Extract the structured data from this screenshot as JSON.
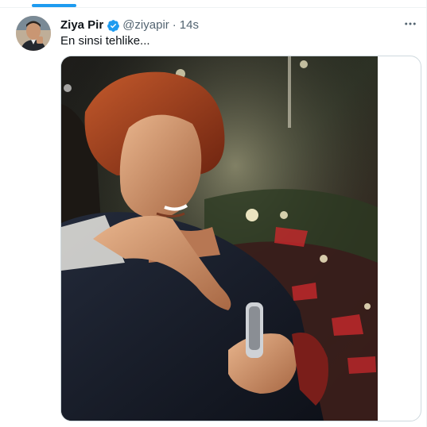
{
  "tweet": {
    "author_name": "Ziya Pir",
    "handle": "@ziyapir",
    "separator": "·",
    "timestamp": "14s",
    "text": "En sinsi tehlike...",
    "more_icon": "more-horizontal-icon",
    "verified_icon": "verified-badge-icon",
    "accent_color": "#1d9bf0"
  }
}
